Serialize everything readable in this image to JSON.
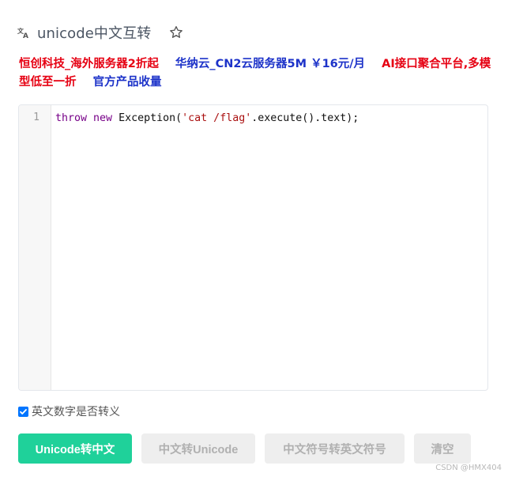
{
  "header": {
    "title": "unicode中文互转"
  },
  "icons": {
    "translate": "translate-icon",
    "star": "star-outline-icon",
    "checkbox": "checkmark-icon"
  },
  "ads": [
    {
      "text": "恒创科技_海外服务器2折起",
      "color": "#e60012"
    },
    {
      "text": "华纳云_CN2云服务器5M ￥16元/月",
      "color": "#1d33c9"
    },
    {
      "text": "AI接口聚合平台,多模型低至一折",
      "color": "#e60012"
    },
    {
      "text": "官方产品收量",
      "color": "#1d33c9"
    }
  ],
  "editor": {
    "line_number": "1",
    "code": {
      "kw1": "throw",
      "kw2": "new",
      "ident": "Exception(",
      "str": "'cat /flag'",
      "rest": ".execute().text);"
    }
  },
  "options": {
    "escape_english_digits_label": "英文数字是否转义",
    "escape_english_digits_checked": true
  },
  "buttons": {
    "unicode_to_chinese": "Unicode转中文",
    "chinese_to_unicode": "中文转Unicode",
    "cn_punct_to_en": "中文符号转英文符号",
    "clear": "清空"
  },
  "watermark": "CSDN @HMX404",
  "colors": {
    "primary": "#1fd19a",
    "ad_red": "#e60012",
    "ad_blue": "#1d33c9",
    "keyword": "#770088",
    "string": "#aa1111"
  }
}
